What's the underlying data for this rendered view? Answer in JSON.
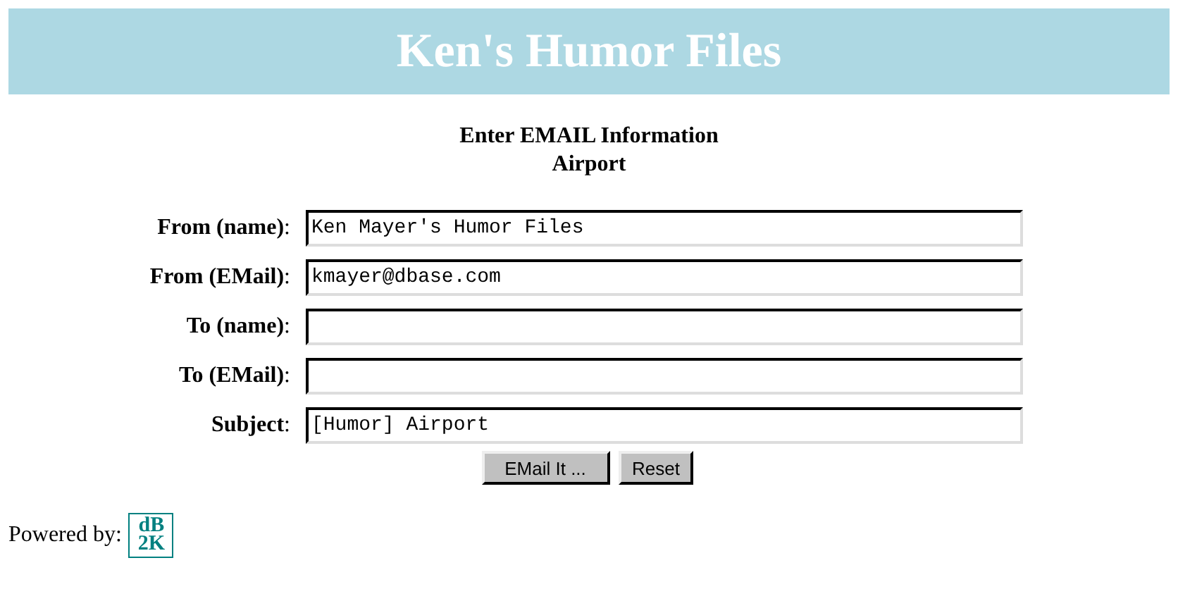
{
  "header": {
    "title": "Ken's Humor Files"
  },
  "heading": [
    "Enter EMAIL Information",
    "Airport"
  ],
  "fields": [
    {
      "label": "**From (name)**:",
      "value": "Ken Mayer's Humor Files"
    },
    {
      "label": "**From (EMail)**:",
      "value": "kmayer@dbase.com"
    },
    {
      "label": "**To (name)**:"
    },
    {
      "label": "**To (EMail)**:"
    },
    {
      "label": "**Subject**:",
      "value": "[Humor] Airport"
    }
  ],
  "buttons": [
    "EMail It ...",
    "Reset"
  ],
  "footer": {
    "label": "Powered by:",
    "logo": [
      "dB",
      "2K"
    ]
  }
}
